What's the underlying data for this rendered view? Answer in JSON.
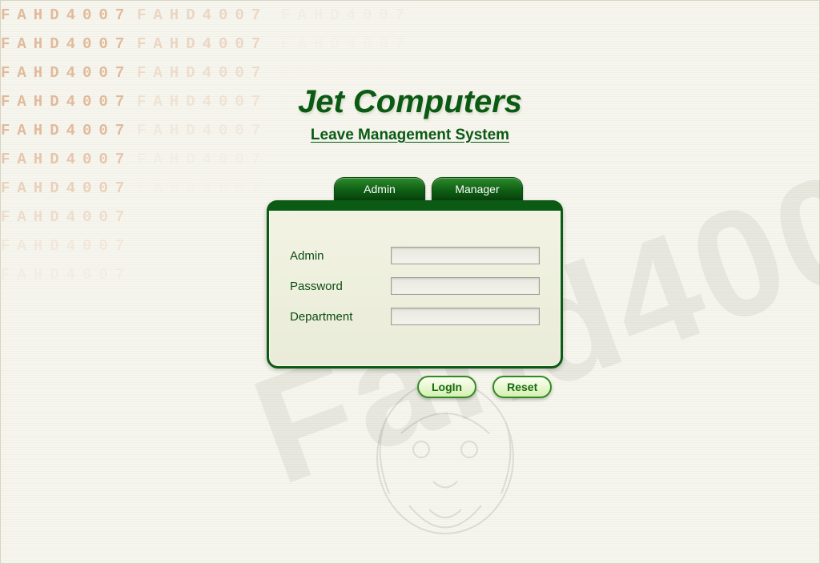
{
  "watermark_text": "FAHD4007",
  "header": {
    "title": "Jet Computers",
    "subtitle": "Leave Management System"
  },
  "tabs": {
    "admin": "Admin",
    "manager": "Manager"
  },
  "form": {
    "user_label": "Admin",
    "password_label": "Password",
    "department_label": "Department",
    "user_value": "",
    "password_value": "",
    "department_value": ""
  },
  "buttons": {
    "login": "LogIn",
    "reset": "Reset"
  },
  "colors": {
    "brand_green": "#0c5b14",
    "accent_green": "#2f8c1f"
  }
}
